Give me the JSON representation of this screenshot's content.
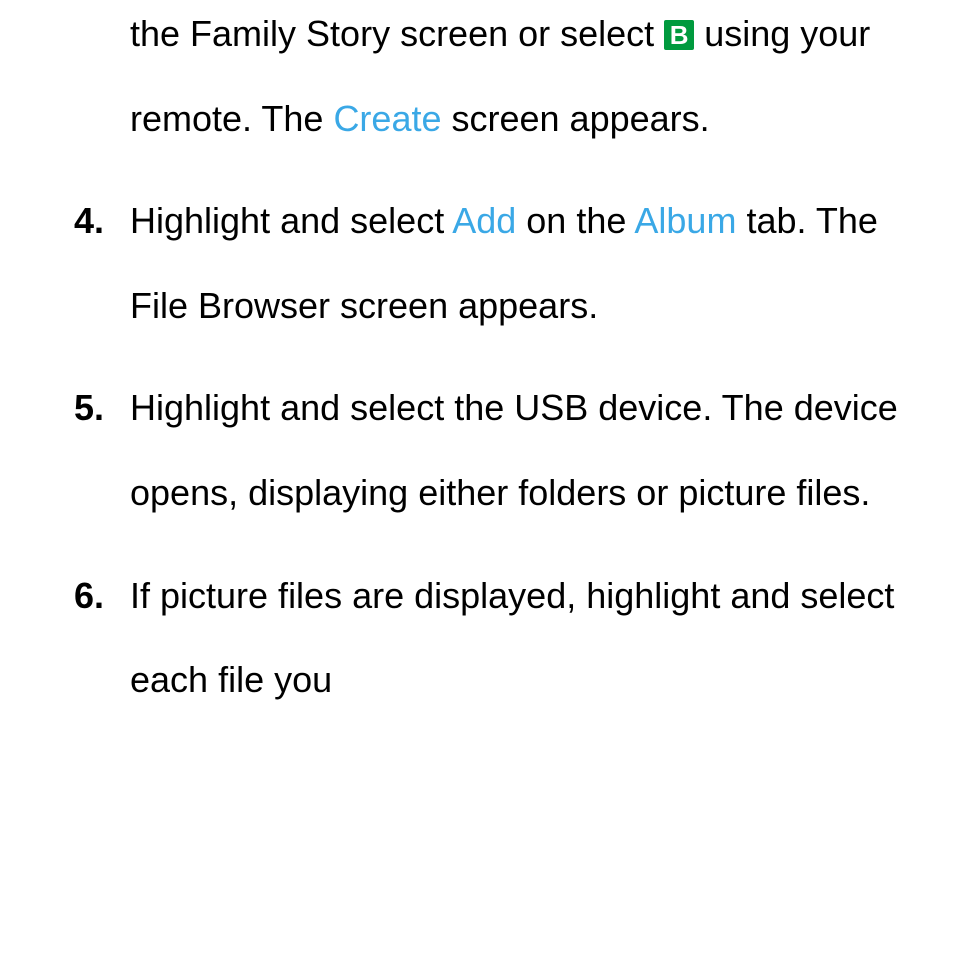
{
  "continuation": {
    "pre": "the Family Story screen or select ",
    "button_letter": "B",
    "mid": " using your remote. The ",
    "hl": "Create",
    "post": " screen appears."
  },
  "steps": [
    {
      "num": "4.",
      "runs": [
        {
          "t": "Highlight and select "
        },
        {
          "t": "Add",
          "hl": true
        },
        {
          "t": " on the "
        },
        {
          "t": "Album",
          "hl": true
        },
        {
          "t": " tab. The File Browser screen appears."
        }
      ]
    },
    {
      "num": "5.",
      "runs": [
        {
          "t": "Highlight and select the USB device. The device opens, displaying either folders or picture files."
        }
      ]
    },
    {
      "num": "6.",
      "runs": [
        {
          "t": "If picture files are displayed, highlight and select each file you"
        }
      ]
    }
  ]
}
